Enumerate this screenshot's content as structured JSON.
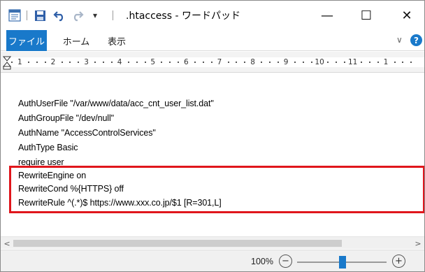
{
  "window": {
    "title": ".htaccess - ワードパッド",
    "minimize_glyph": "—",
    "maximize_glyph": "☐",
    "close_glyph": "✕",
    "quick_access_dropdown_glyph": "▾"
  },
  "ribbon": {
    "tabs": [
      {
        "label": "ファイル",
        "active": true
      },
      {
        "label": "ホーム",
        "active": false
      },
      {
        "label": "表示",
        "active": false
      }
    ],
    "collapse_glyph": "∨",
    "help_glyph": "?"
  },
  "ruler": {
    "numbers": [
      "1",
      "2",
      "3",
      "4",
      "5",
      "6",
      "7",
      "8",
      "9",
      "10",
      "11",
      "1"
    ]
  },
  "document": {
    "lines": [
      "AuthUserFile \"/var/www/data/acc_cnt_user_list.dat\"",
      "AuthGroupFile \"/dev/null\"",
      "AuthName \"AccessControlServices\"",
      "AuthType Basic",
      "require user",
      "RewriteEngine on",
      "RewriteCond %{HTTPS} off",
      "RewriteRule ^(.*)$ https://www.xxx.co.jp/$1 [R=301,L]"
    ],
    "highlight_color": "#e0161c"
  },
  "scrollbar": {
    "left_arrow": "<",
    "right_arrow": ">"
  },
  "statusbar": {
    "zoom_level": "100%",
    "zoom_out_glyph": "−",
    "zoom_in_glyph": "+"
  },
  "colors": {
    "accent": "#1979ca"
  }
}
